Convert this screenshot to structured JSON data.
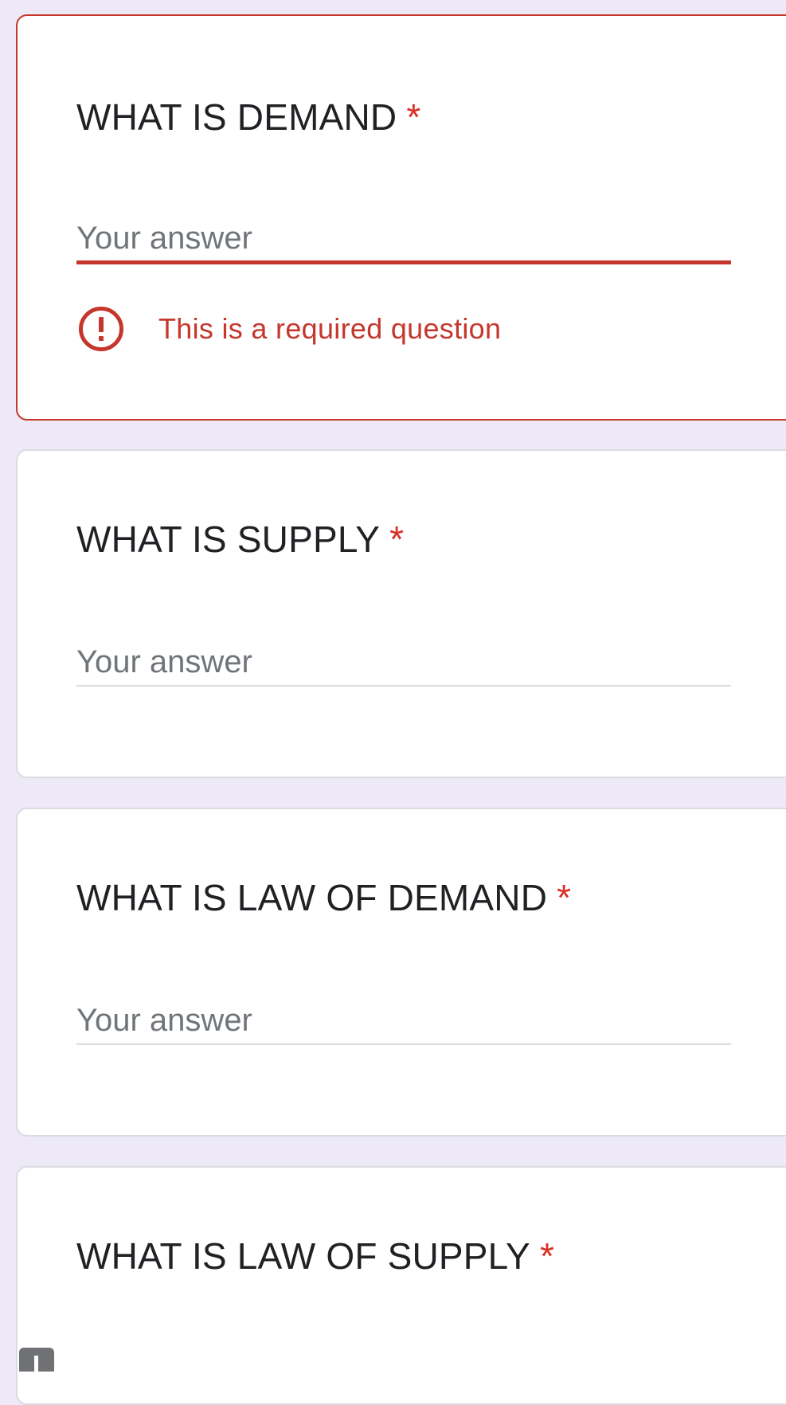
{
  "questions": [
    {
      "title": "WHAT IS DEMAND",
      "required_mark": "*",
      "placeholder": "Your answer",
      "value": "",
      "error": "This is a required question"
    },
    {
      "title": "WHAT IS SUPPLY",
      "required_mark": "*",
      "placeholder": "Your answer",
      "value": ""
    },
    {
      "title": "WHAT IS LAW OF DEMAND",
      "required_mark": "*",
      "placeholder": "Your answer",
      "value": ""
    },
    {
      "title": "WHAT IS LAW OF SUPPLY",
      "required_mark": "*"
    }
  ],
  "icons": {
    "error": "error-circle-icon"
  },
  "colors": {
    "background": "#ede9f6",
    "error": "#c5372c",
    "required": "#d93025",
    "card_border": "#dadce0"
  }
}
